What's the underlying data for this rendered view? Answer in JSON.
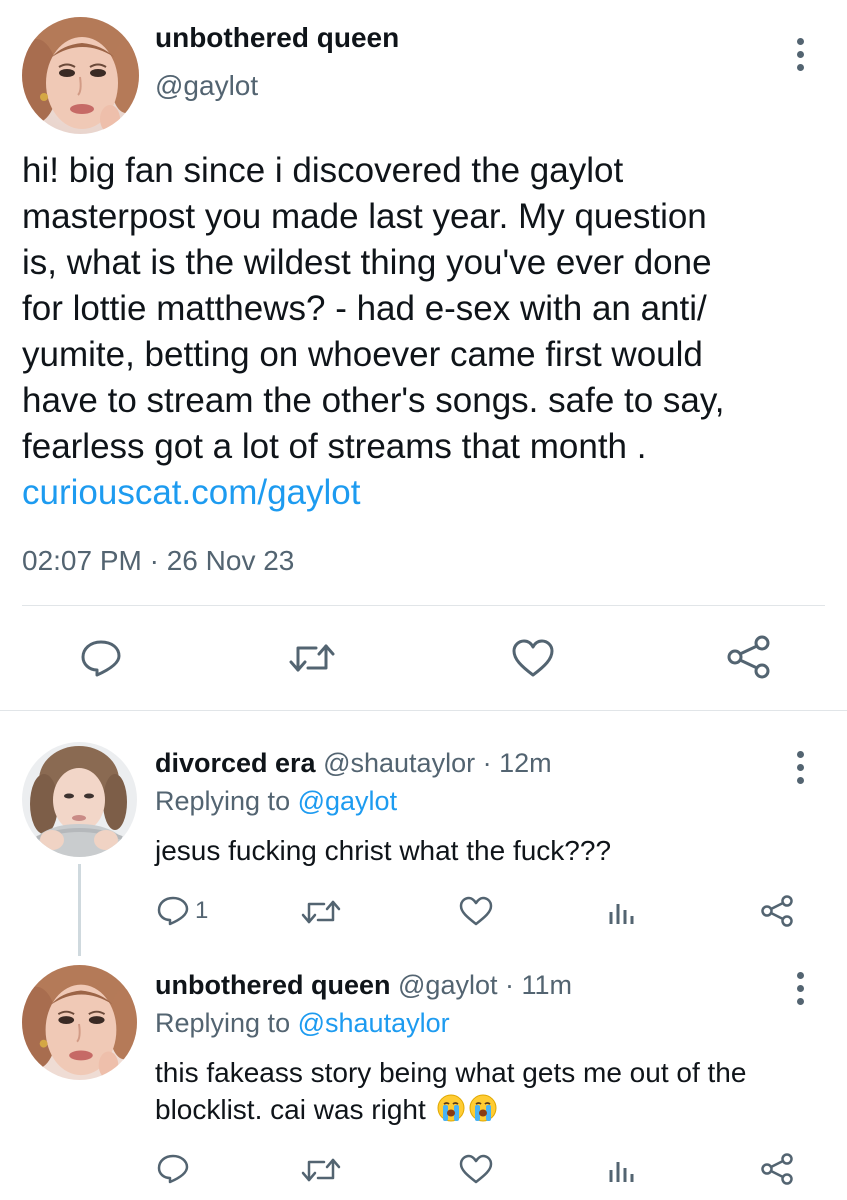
{
  "main_tweet": {
    "display_name": "unbothered queen",
    "handle": "@gaylot",
    "avatar_icon": "avatar-photo",
    "body_lines": [
      "hi! big fan since i discovered the gaylot",
      "masterpost you made last year. My question",
      "is, what is the wildest thing you've ever done",
      "for lottie matthews? - had e-sex with an anti/",
      "yumite, betting on whoever came first would",
      "have to stream the other's songs. safe to say,",
      "fearless got a lot of streams that month  ."
    ],
    "link": "curiouscat.com/gaylot",
    "timestamp": "02:07 PM · 26 Nov 23",
    "actions": {
      "reply_icon": "reply-icon",
      "retweet_icon": "retweet-icon",
      "like_icon": "heart-icon",
      "share_icon": "share-icon"
    }
  },
  "replies": [
    {
      "display_name": "divorced era",
      "meta": "@shautaylor · 12m",
      "replying_label": "Replying to",
      "replying_to": "@gaylot",
      "text_lines": [
        "jesus fucking christ what the fuck???"
      ],
      "reply_count": "1"
    },
    {
      "display_name": "unbothered queen",
      "meta": "@gaylot · 11m",
      "replying_label": "Replying to",
      "replying_to": "@shautaylor",
      "text_lines": [
        "this fakeass story being what gets me out of the",
        "blocklist. cai was right"
      ],
      "emoji": [
        "loudly-crying-face",
        "loudly-crying-face"
      ],
      "reply_count": ""
    }
  ],
  "colors": {
    "text": "#0f1419",
    "secondary": "#536471",
    "link": "#1d9bf0",
    "divider": "#e1e5e8"
  }
}
